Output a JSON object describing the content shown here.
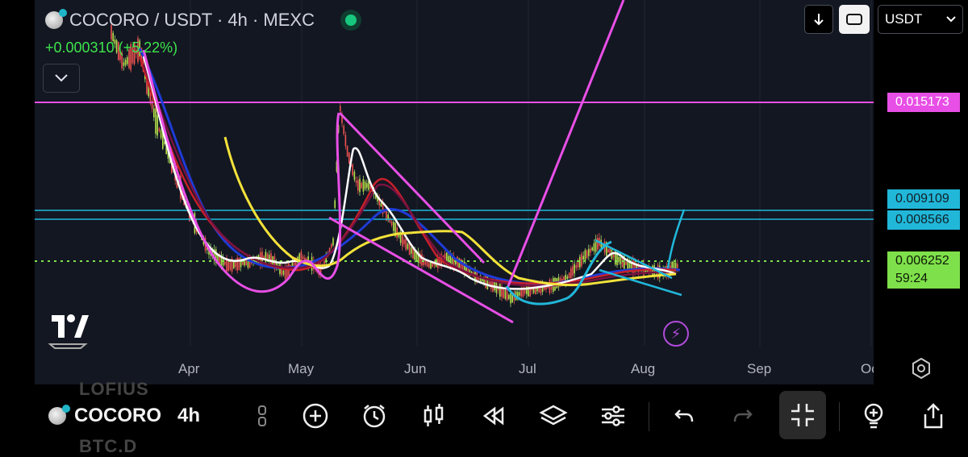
{
  "header": {
    "title": "COCORO / USDT · 4h · MEXC",
    "change": "+0.000310 (+5.22%)"
  },
  "top_controls": {
    "currency": "USDT"
  },
  "price_scale": {
    "upper_level": "0.015173",
    "cyan_level_1": "0.009109",
    "cyan_level_2": "0.008566",
    "current_price": "0.006252",
    "countdown": "59:24"
  },
  "time_axis": {
    "months": [
      "Apr",
      "May",
      "Jun",
      "Jul",
      "Aug",
      "Sep",
      "Oc"
    ]
  },
  "toolbar": {
    "symbol": "COCORO",
    "interval": "4h",
    "ghost_above": "LOFIUS",
    "ghost_below": "BTC.D"
  },
  "colors": {
    "background": "#131722",
    "magenta": "#e84fe6",
    "cyan": "#21b7d9",
    "current_price": "#7ee04a",
    "yellow_ma": "#f2e23a",
    "white_ma": "#ffffff"
  },
  "icons": {
    "toolbar": [
      "drag-handle-icon",
      "add-icon",
      "alarm-icon",
      "candles-icon",
      "replay-icon",
      "layers-icon",
      "settings-sliders-icon",
      "undo-icon",
      "redo-icon",
      "fullscreen-exit-icon",
      "bulb-icon",
      "share-icon"
    ]
  }
}
